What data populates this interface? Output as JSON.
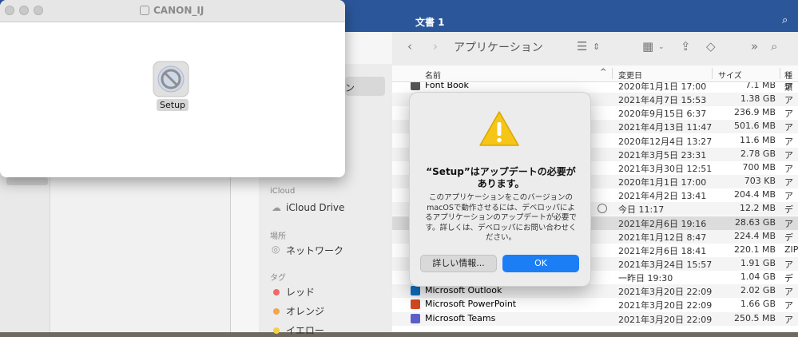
{
  "word_window": {
    "title": "文書 1"
  },
  "canon_window": {
    "title": "CANON_IJ",
    "file_label": "Setup"
  },
  "finder": {
    "title": "アプリケーション",
    "columns": {
      "name": "名前",
      "modified": "変更日",
      "size": "サイズ",
      "kind": "種類"
    },
    "sidebar": {
      "partial_item": "ン",
      "icloud_section": "iCloud",
      "icloud_drive": "iCloud Drive",
      "locations_section": "場所",
      "network": "ネットワーク",
      "tags_section": "タグ",
      "tags": [
        {
          "label": "レッド",
          "color": "#ec6a6a"
        },
        {
          "label": "オレンジ",
          "color": "#f3a54a"
        },
        {
          "label": "イエロー",
          "color": "#f2d04b"
        }
      ]
    },
    "rows": [
      {
        "name": "Font Book",
        "date": "2020年1月1日 17:00",
        "size": "7.1 MB",
        "kind": "ア"
      },
      {
        "name": "",
        "date": "2021年4月7日 15:53",
        "size": "1.38 GB",
        "kind": "ア"
      },
      {
        "name": "",
        "date": "2020年9月15日 6:37",
        "size": "236.9 MB",
        "kind": "ア"
      },
      {
        "name": "",
        "date": "2021年4月13日 11:47",
        "size": "501.6 MB",
        "kind": "ア"
      },
      {
        "name": "",
        "date": "2020年12月4日 13:27",
        "size": "11.6 MB",
        "kind": "ア"
      },
      {
        "name": "",
        "date": "2021年3月5日 23:31",
        "size": "2.78 GB",
        "kind": "ア"
      },
      {
        "name": "",
        "date": "2021年3月30日 12:51",
        "size": "700 MB",
        "kind": "ア"
      },
      {
        "name": "",
        "date": "2020年1月1日 17:00",
        "size": "703 KB",
        "kind": "ア"
      },
      {
        "name": "",
        "date": "2021年4月2日 13:41",
        "size": "204.4 MB",
        "kind": "ア"
      },
      {
        "name": "",
        "date": "今日 11:17",
        "size": "12.2 MB",
        "kind": "デ"
      },
      {
        "name": "",
        "date": "2021年2月6日 19:16",
        "size": "28.63 GB",
        "kind": "ア"
      },
      {
        "name": "",
        "date": "2021年1月12日 8:47",
        "size": "224.4 MB",
        "kind": "デ"
      },
      {
        "name": "",
        "date": "2021年2月6日 18:41",
        "size": "220.1 MB",
        "kind": "ZIP"
      },
      {
        "name": "",
        "date": "2021年3月24日 15:57",
        "size": "1.91 GB",
        "kind": "ア"
      },
      {
        "name": "",
        "date": "一昨日 19:30",
        "size": "1.04 GB",
        "kind": "デ"
      },
      {
        "name": "Microsoft Outlook",
        "date": "2021年3月20日 22:09",
        "size": "2.02 GB",
        "kind": "ア"
      },
      {
        "name": "Microsoft PowerPoint",
        "date": "2021年3月20日 22:09",
        "size": "1.66 GB",
        "kind": "ア"
      },
      {
        "name": "Microsoft Teams",
        "date": "2021年3月20日 22:09",
        "size": "250.5 MB",
        "kind": "ア"
      }
    ]
  },
  "alert": {
    "title": "“Setup”はアップデートの必要があります。",
    "body": "このアプリケーションをこのバージョンのmacOSで動作させるには、デベロッパによるアプリケーションのアップデートが必要です。詳しくは、デベロッパにお問い合わせください。",
    "more_button": "詳しい情報...",
    "ok_button": "OK"
  },
  "colors": {
    "ok_blue": "#1c7ef5",
    "word_blue": "#2b579a",
    "warning_yellow": "#f5c518"
  }
}
